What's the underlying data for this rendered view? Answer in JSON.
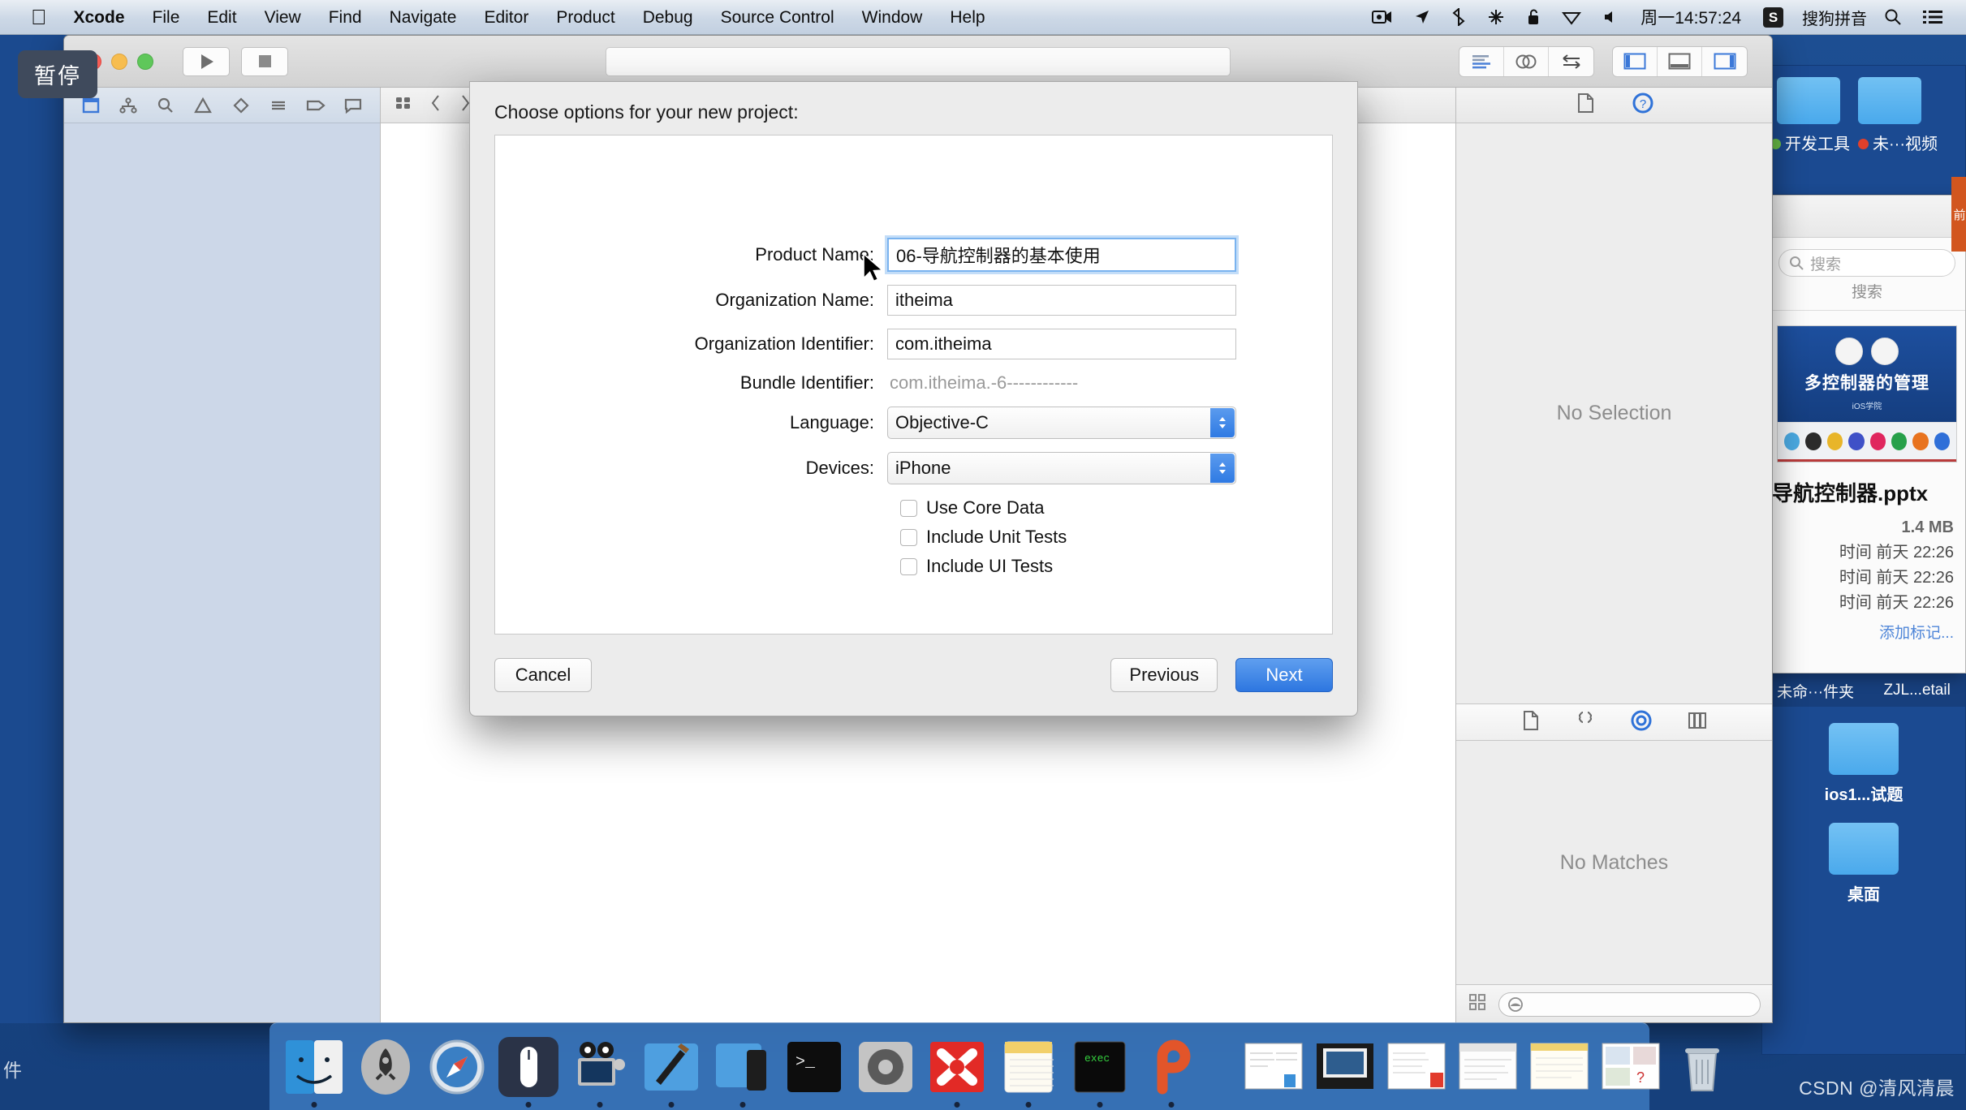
{
  "menubar": {
    "apple_icon": "apple-logo",
    "items": [
      "Xcode",
      "File",
      "Edit",
      "View",
      "Find",
      "Navigate",
      "Editor",
      "Product",
      "Debug",
      "Source Control",
      "Window",
      "Help"
    ],
    "status_icons": [
      "screen-record-icon",
      "location-arrow-icon",
      "bluetooth-icon",
      "airdrop-icon",
      "lock-icon",
      "wifi-icon",
      "volume-icon"
    ],
    "clock": "周一14:57:24",
    "ime_badge": "S",
    "ime_label": "搜狗拼音",
    "spotlight_icon": "search-icon",
    "notification_icon": "list-icon"
  },
  "tooltip": {
    "text": "暂停"
  },
  "xcode": {
    "toolbar": {
      "run_icon": "play-icon",
      "stop_icon": "stop-icon",
      "status_placeholder": "",
      "editor_segment": [
        "standard-editor-icon",
        "assistant-editor-icon",
        "version-editor-icon"
      ],
      "view_segment": [
        "toggle-navigator-icon",
        "toggle-debug-area-icon",
        "toggle-inspector-icon"
      ]
    },
    "navigator_tabs": [
      "project-navigator-icon",
      "source-control-navigator-icon",
      "find-navigator-icon",
      "issue-navigator-icon",
      "test-navigator-icon",
      "debug-navigator-icon",
      "breakpoint-navigator-icon",
      "report-navigator-icon"
    ],
    "jumpbar": [
      "related-items-icon",
      "back-chevron-icon",
      "forward-chevron-icon"
    ],
    "inspector": {
      "tabs": [
        "file-inspector-icon",
        "quick-help-icon"
      ],
      "empty_text": "No Selection",
      "library_tabs": [
        "file-template-library-icon",
        "code-snippet-library-icon",
        "object-library-icon",
        "media-library-icon"
      ],
      "library_empty_text": "No Matches",
      "search_icon": "filter-icon",
      "grid_icon": "grid-icon",
      "search_placeholder": ""
    }
  },
  "sheet": {
    "title": "Choose options for your new project:",
    "fields": [
      {
        "label": "Product Name:",
        "value": "06-导航控制器的基本使用",
        "type": "text",
        "focused": true
      },
      {
        "label": "Organization Name:",
        "value": "itheima",
        "type": "text",
        "focused": false
      },
      {
        "label": "Organization Identifier:",
        "value": "com.itheima",
        "type": "text",
        "focused": false
      },
      {
        "label": "Bundle Identifier:",
        "value": "com.itheima.-6------------",
        "type": "static",
        "focused": false
      },
      {
        "label": "Language:",
        "value": "Objective-C",
        "type": "popup",
        "focused": false
      },
      {
        "label": "Devices:",
        "value": "iPhone",
        "type": "popup",
        "focused": false
      }
    ],
    "checkboxes": [
      {
        "label": "Use Core Data",
        "checked": false
      },
      {
        "label": "Include Unit Tests",
        "checked": false
      },
      {
        "label": "Include UI Tests",
        "checked": false
      }
    ],
    "buttons": {
      "cancel": "Cancel",
      "previous": "Previous",
      "next": "Next"
    }
  },
  "finder": {
    "top_window": {
      "labels": [
        "开发工具",
        "未···视频"
      ],
      "dot_colors": [
        "#6cc24a",
        "#e0402b"
      ]
    },
    "info_window": {
      "search_placeholder": "搜索",
      "search_icon": "search-icon",
      "subtitle": "搜索",
      "preview_title": "多控制器的管理",
      "preview_subtitle": "iOS学院",
      "file_name": "导航控制器.pptx",
      "size": "1.4 MB",
      "meta_rows": [
        {
          "label": "时间",
          "value": "前天 22:26"
        },
        {
          "label": "时间",
          "value": "前天 22:26"
        },
        {
          "label": "时间",
          "value": "前天 22:26"
        }
      ],
      "add_tag": "添加标记..."
    },
    "bottom_window": {
      "tabs": [
        "未命···件夹",
        "ZJL...etail"
      ],
      "folders": [
        "ios1...试题",
        "桌面"
      ]
    },
    "orange_tab_label": "前"
  },
  "dock": {
    "items": [
      {
        "name": "finder-icon",
        "running": true
      },
      {
        "name": "launchpad-icon",
        "running": false
      },
      {
        "name": "safari-icon",
        "running": false
      },
      {
        "name": "mouse-app-icon",
        "running": true
      },
      {
        "name": "quicktime-icon",
        "running": true
      },
      {
        "name": "xcode-icon",
        "running": true
      },
      {
        "name": "simulator-icon",
        "running": true
      },
      {
        "name": "terminal-icon",
        "running": false
      },
      {
        "name": "system-preferences-icon",
        "running": false
      },
      {
        "name": "xmind-icon",
        "running": true
      },
      {
        "name": "notes-icon",
        "running": true
      },
      {
        "name": "iterm-icon",
        "running": true
      },
      {
        "name": "paste-icon",
        "running": true
      }
    ],
    "minimized": [
      {
        "name": "minimized-window-doc"
      },
      {
        "name": "minimized-window-display"
      },
      {
        "name": "minimized-window-sheet"
      },
      {
        "name": "minimized-window-browser"
      },
      {
        "name": "minimized-window-note"
      },
      {
        "name": "minimized-window-slides"
      }
    ],
    "trash_icon": "trash-icon",
    "separator": "dock-separator"
  },
  "watermark": {
    "text": "CSDN @清风清晨"
  },
  "colors": {
    "accent_blue": "#2d76e0",
    "menubar_bg": "#ccd8e6",
    "sheet_bg": "#ececec",
    "desktop_blue": "#1a4686"
  }
}
